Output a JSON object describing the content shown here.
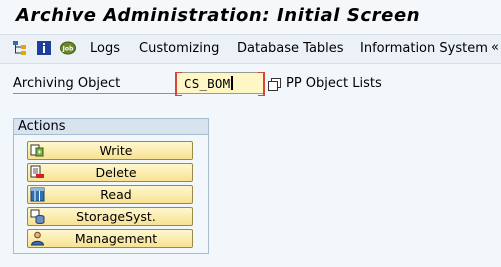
{
  "window": {
    "title": "Archive Administration: Initial Screen"
  },
  "toolbar": {
    "icons": [
      "structure-icon",
      "info-icon",
      "job-icon"
    ],
    "menu": [
      {
        "label": "Logs"
      },
      {
        "label": "Customizing"
      },
      {
        "label": "Database Tables"
      },
      {
        "label": "Information System"
      }
    ],
    "more_glyph": "«"
  },
  "form": {
    "object_label": "Archiving Object",
    "object_value": "CS_BOM",
    "object_description": "PP Object Lists"
  },
  "actions": {
    "title": "Actions",
    "buttons": [
      {
        "label": "Write",
        "icon": "write-icon"
      },
      {
        "label": "Delete",
        "icon": "delete-icon"
      },
      {
        "label": "Read",
        "icon": "read-icon"
      },
      {
        "label": "StorageSyst.",
        "icon": "storage-system-icon"
      },
      {
        "label": "Management",
        "icon": "management-icon"
      }
    ]
  },
  "colors": {
    "background": "#f2f7fb",
    "input_background": "#fff6c6",
    "button_background": "#f7e293",
    "group_header": "#d7e3ee"
  }
}
